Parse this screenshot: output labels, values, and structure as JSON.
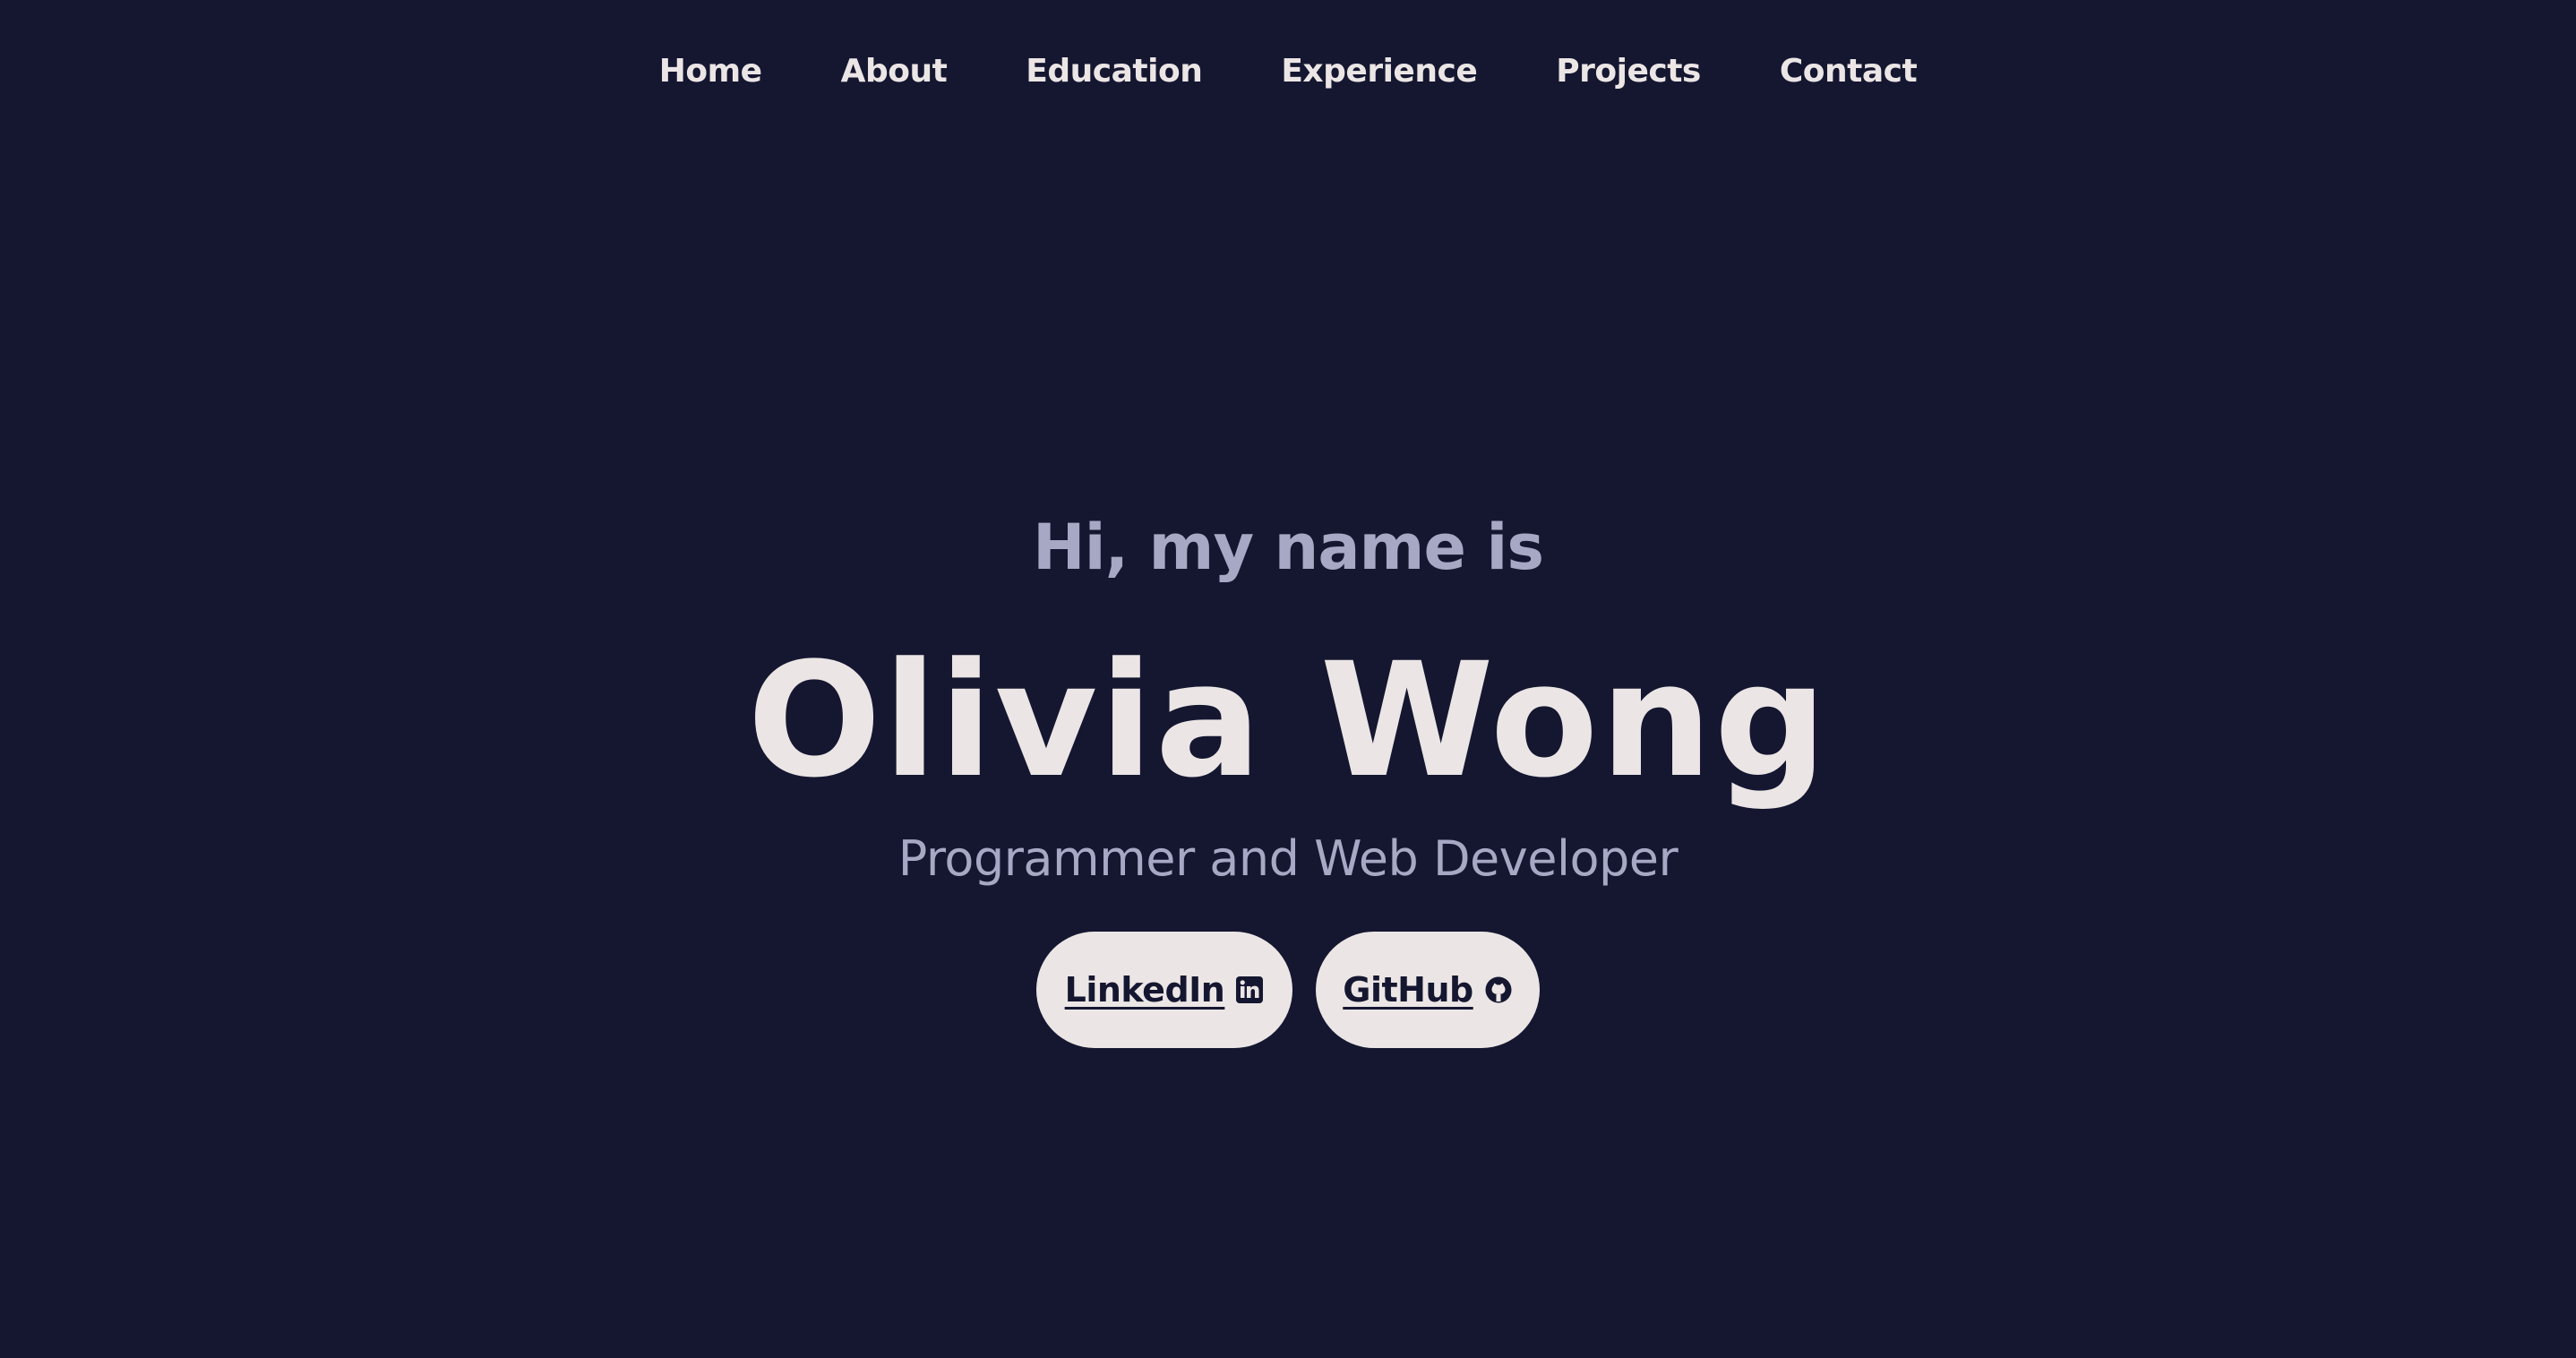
{
  "nav": {
    "items": [
      {
        "label": "Home"
      },
      {
        "label": "About"
      },
      {
        "label": "Education"
      },
      {
        "label": "Experience"
      },
      {
        "label": "Projects"
      },
      {
        "label": "Contact"
      }
    ]
  },
  "hero": {
    "greeting": "Hi, my name is",
    "name": "Olivia Wong",
    "role": "Programmer and Web Developer",
    "buttons": {
      "linkedin": {
        "label": "LinkedIn",
        "icon": "linkedin-icon"
      },
      "github": {
        "label": "GitHub",
        "icon": "github-icon"
      }
    }
  },
  "colors": {
    "background": "#151731",
    "text": "#ebe6e5",
    "muted": "#a7a8c3"
  }
}
